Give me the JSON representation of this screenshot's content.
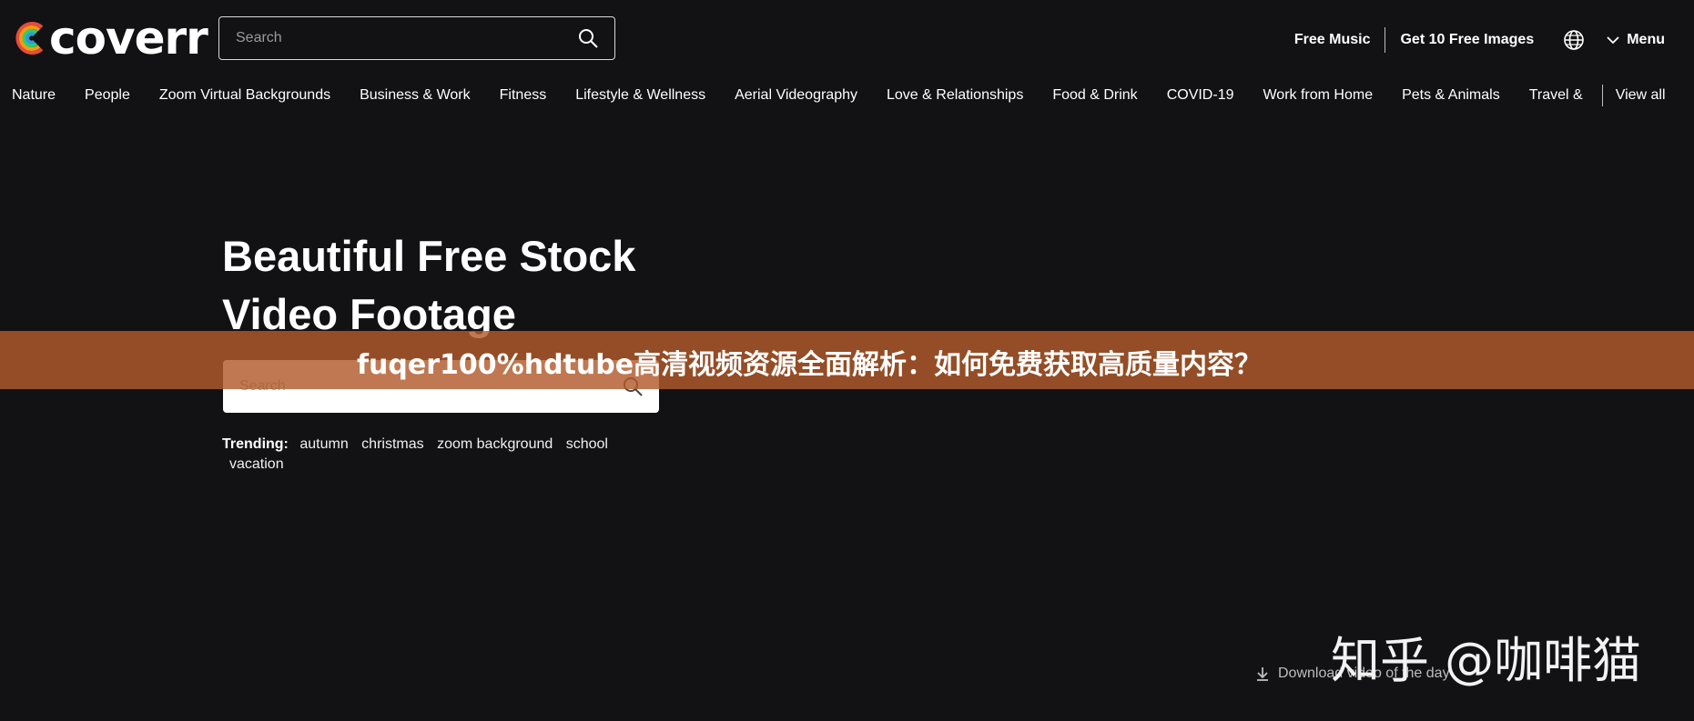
{
  "brand": {
    "logo_text": "coverr"
  },
  "header": {
    "search_placeholder": "Search",
    "links": [
      "Free Music",
      "Get 10 Free Images"
    ],
    "menu_label": "Menu"
  },
  "nav": {
    "items": [
      "Nature",
      "People",
      "Zoom Virtual Backgrounds",
      "Business & Work",
      "Fitness",
      "Lifestyle & Wellness",
      "Aerial Videography",
      "Love & Relationships",
      "Food & Drink",
      "COVID-19",
      "Work from Home",
      "Pets & Animals",
      "Travel &"
    ],
    "view_all": "View all"
  },
  "hero": {
    "title_line1": "Beautiful Free Stock",
    "title_line2": "Video Footage",
    "search_placeholder": "Search",
    "trending_label": "Trending:",
    "trending_tags": [
      "autumn",
      "christmas",
      "zoom background",
      "school",
      "vacation"
    ]
  },
  "overlay": {
    "banner_text": "fuqer100%hdtube高清视频资源全面解析：如何免费获取高质量内容？",
    "watermark": "知乎 @咖啡猫"
  },
  "footer": {
    "download_label": "Download video of the day"
  },
  "colors": {
    "background": "#121214",
    "banner": "#b15a2b",
    "text": "#ffffff"
  }
}
